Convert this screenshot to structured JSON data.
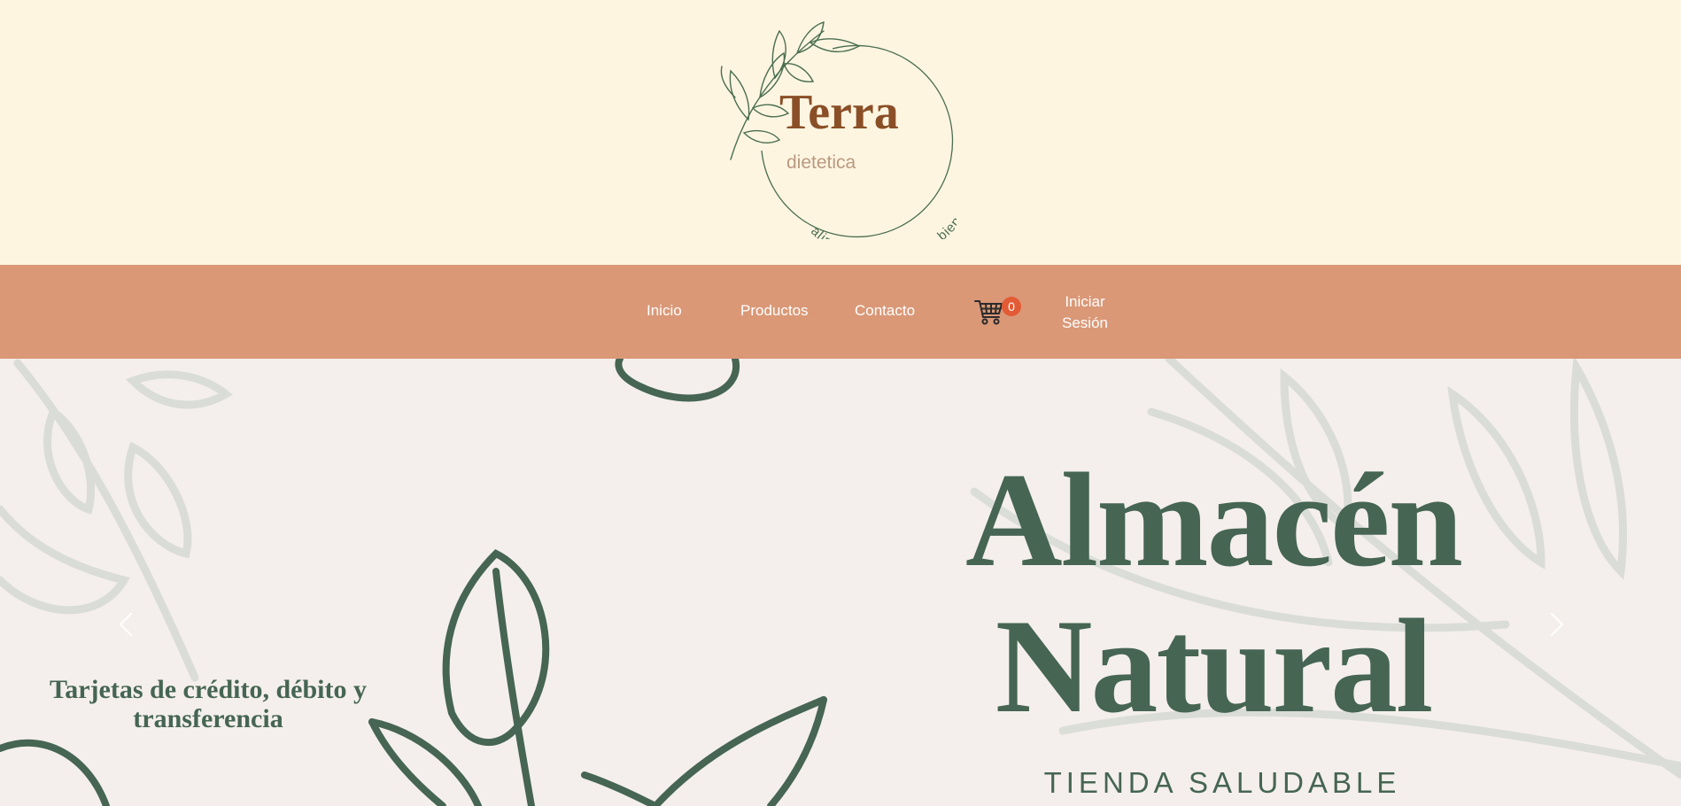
{
  "brand": {
    "name": "Terra",
    "subtitle": "dietetica",
    "tagline": "alimentos que hacen bien",
    "colors": {
      "name": "#8a4f27",
      "subtitle": "#b99a80",
      "leaf": "#4a6e4f"
    }
  },
  "navbar": {
    "background": "#da9877",
    "items": [
      {
        "label": "Inicio"
      },
      {
        "label": "Productos"
      },
      {
        "label": "Contacto"
      }
    ],
    "cart": {
      "icon": "shopping-cart-icon",
      "count": "0"
    },
    "login_label": "Iniciar Sesión"
  },
  "hero": {
    "title": "Almacén Natural",
    "subtitle": "TIENDA SALUDABLE",
    "payment_text": "Tarjetas de crédito, débito y transferencia",
    "prev_icon": "chevron-left-icon",
    "next_icon": "chevron-right-icon",
    "accent": "#466553"
  },
  "colors": {
    "header_bg": "#fef5e1",
    "hero_bg": "#f4efec",
    "badge": "#e35b35"
  }
}
